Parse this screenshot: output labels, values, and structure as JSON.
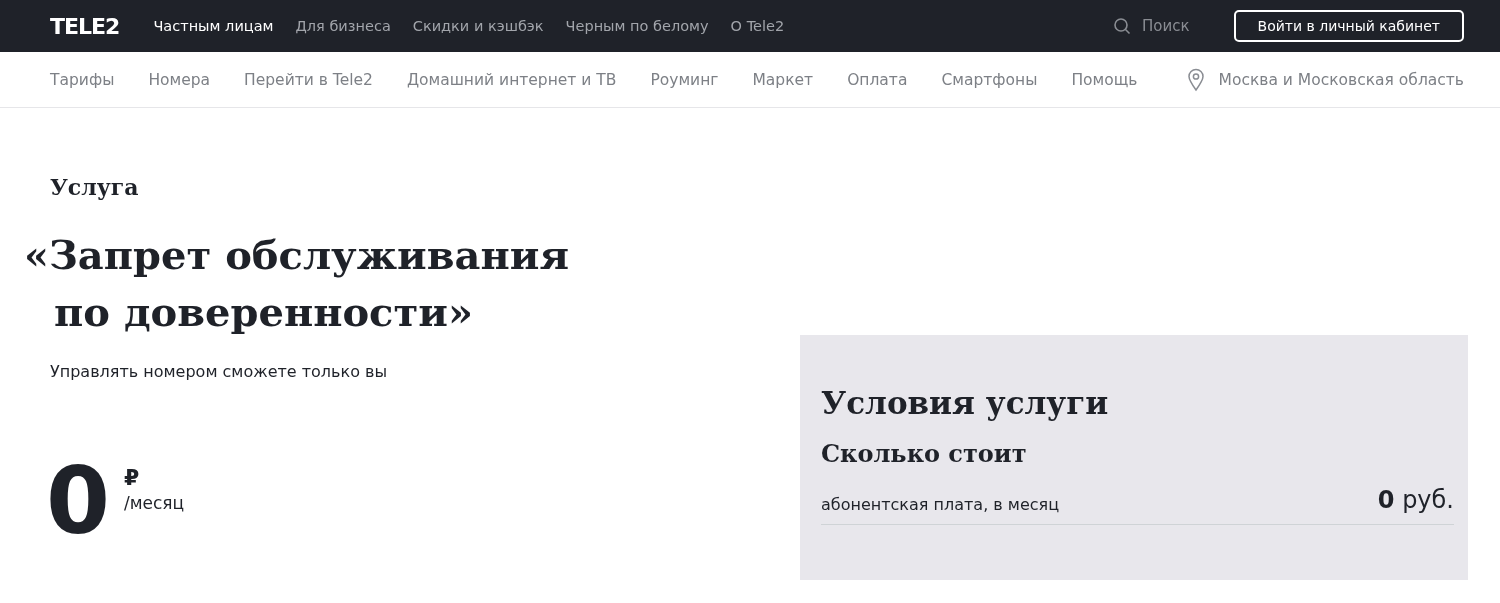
{
  "header": {
    "logo": "TELE2",
    "nav": [
      {
        "label": "Частным лицам",
        "selected": true
      },
      {
        "label": "Для бизнеса",
        "selected": false
      },
      {
        "label": "Скидки и кэшбэк",
        "selected": false
      },
      {
        "label": "Черным по белому",
        "selected": false
      },
      {
        "label": "О Tele2",
        "selected": false
      }
    ],
    "search": "Поиск",
    "login_button": "Войти в личный кабинет"
  },
  "subnav": {
    "items": [
      "Тарифы",
      "Номера",
      "Перейти в Tele2",
      "Домашний интернет и ТВ",
      "Роуминг",
      "Маркет",
      "Оплата",
      "Смартфоны",
      "Помощь"
    ],
    "region": "Москва и Московская область"
  },
  "service": {
    "label": "Услуга",
    "title": "«Запрет обслуживания по доверенности»",
    "subtitle": "Управлять номером сможете только вы",
    "price": "0",
    "currency": "₽",
    "period": "/месяц"
  },
  "conditions": {
    "title": "Условия услуги",
    "section": "Сколько стоит",
    "rows": [
      {
        "label": "абонентская плата, в месяц",
        "amount": "0",
        "unit": "руб."
      }
    ]
  }
}
